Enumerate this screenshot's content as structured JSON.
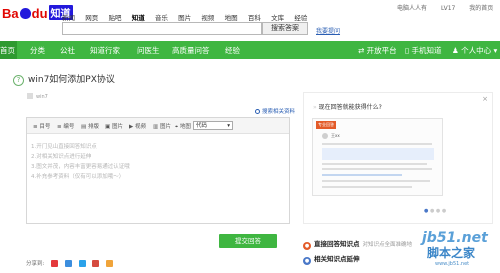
{
  "logo": {
    "part1": "Ba",
    "part3": "du",
    "badge": "知道"
  },
  "nav": {
    "items": [
      "新闻",
      "网页",
      "贴吧",
      "知道",
      "音乐",
      "图片",
      "视频",
      "地图",
      "百科",
      "文库",
      "经验"
    ],
    "active_index": 3
  },
  "user": {
    "name": "电脑人人有",
    "level": "LV17",
    "home": "我的首页"
  },
  "search": {
    "button_label": "搜索答案",
    "ask_link": "我要提问"
  },
  "greenbar": {
    "items": [
      "首页",
      "分类",
      "公社",
      "知道行家",
      "问医生",
      "高质量问答",
      "经验"
    ],
    "right_items": [
      "开放平台",
      "手机知道",
      "个人中心"
    ]
  },
  "question": {
    "title": "win7如何添加PX协议",
    "asker": "win7"
  },
  "related_link": "搜索相关资料",
  "toolbar": {
    "items": [
      "目号",
      "编号",
      "排版",
      "图片",
      "视频",
      "图片",
      "地图"
    ],
    "code_value": "代码"
  },
  "hints": [
    "1.开门见山直接回答知识点",
    "2.对相关知识点进行延伸",
    "3.图文并茂，内容丰富更容易通过认证哦",
    "4.补充参考资料（仅有可以添加哦～）"
  ],
  "panel": {
    "close": "×",
    "title": "现在回答就能获得什么?",
    "badge": "专业回答",
    "uname": "王xx"
  },
  "features": [
    {
      "bold": "直接回答知识点",
      "desc": "对知识点全面准确地",
      "color": "#e35b29"
    },
    {
      "bold": "相关知识点延伸",
      "desc": "",
      "color": "#4a78c8"
    }
  ],
  "submit_label": "提交回答",
  "share": {
    "label": "分享到:"
  },
  "watermark": {
    "line1": "jb51.net",
    "line2": "脚本之家",
    "line3": "www.jb51.net"
  }
}
